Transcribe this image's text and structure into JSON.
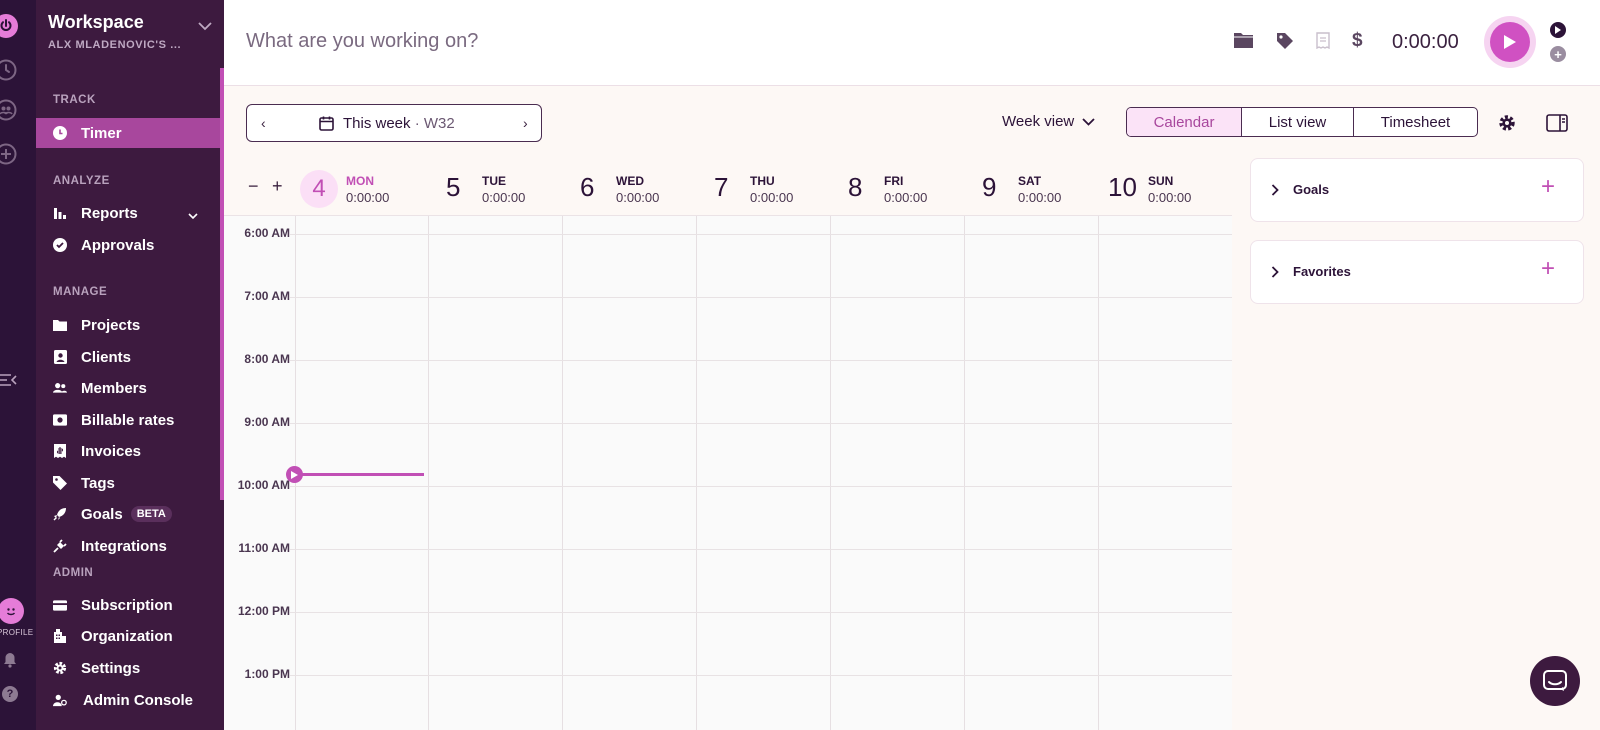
{
  "sidebar": {
    "workspace_name": "Workspace",
    "workspace_owner": "ALX MLADENOVIC'S ...",
    "sections": {
      "track": "TRACK",
      "analyze": "ANALYZE",
      "manage": "MANAGE",
      "admin": "ADMIN"
    },
    "items": {
      "timer": "Timer",
      "reports": "Reports",
      "approvals": "Approvals",
      "projects": "Projects",
      "clients": "Clients",
      "members": "Members",
      "billable_rates": "Billable rates",
      "invoices": "Invoices",
      "tags": "Tags",
      "goals": "Goals",
      "goals_badge": "BETA",
      "integrations": "Integrations",
      "subscription": "Subscription",
      "organization": "Organization",
      "settings": "Settings",
      "admin_console": "Admin Console"
    },
    "active_item": "Timer",
    "active_color": "#a8479d"
  },
  "rail": {
    "profile_label": "PROFILE",
    "help_glyph": "?",
    "icons": [
      "power-icon",
      "clock-icon",
      "people-icon",
      "plus-circle-icon",
      "collapse-sidebar-icon",
      "avatar",
      "bell-icon",
      "help-icon"
    ]
  },
  "topbar": {
    "description_placeholder": "What are you working on?",
    "timer_value": "0:00:00",
    "icons": [
      "folder-icon",
      "tag-icon",
      "receipt-icon",
      "dollar-icon",
      "play-icon"
    ],
    "brand_color": "#d051c2"
  },
  "toolbar": {
    "week_label": "This week",
    "week_separator": "·",
    "week_number": "W32",
    "view_mode": "Week view",
    "tabs": [
      "Calendar",
      "List view",
      "Timesheet"
    ],
    "active_tab": "Calendar"
  },
  "calendar": {
    "zoom_out": "−",
    "zoom_in": "+",
    "days": [
      {
        "num": "4",
        "name": "MON",
        "total": "0:00:00",
        "today": true
      },
      {
        "num": "5",
        "name": "TUE",
        "total": "0:00:00"
      },
      {
        "num": "6",
        "name": "WED",
        "total": "0:00:00"
      },
      {
        "num": "7",
        "name": "THU",
        "total": "0:00:00"
      },
      {
        "num": "8",
        "name": "FRI",
        "total": "0:00:00"
      },
      {
        "num": "9",
        "name": "SAT",
        "total": "0:00:00"
      },
      {
        "num": "10",
        "name": "SUN",
        "total": "0:00:00"
      }
    ],
    "hours": [
      "6:00 AM",
      "7:00 AM",
      "8:00 AM",
      "9:00 AM",
      "10:00 AM",
      "11:00 AM",
      "12:00 PM",
      "1:00 PM"
    ]
  },
  "right_panel": {
    "goals": "Goals",
    "favorites": "Favorites",
    "add_glyph": "+"
  }
}
